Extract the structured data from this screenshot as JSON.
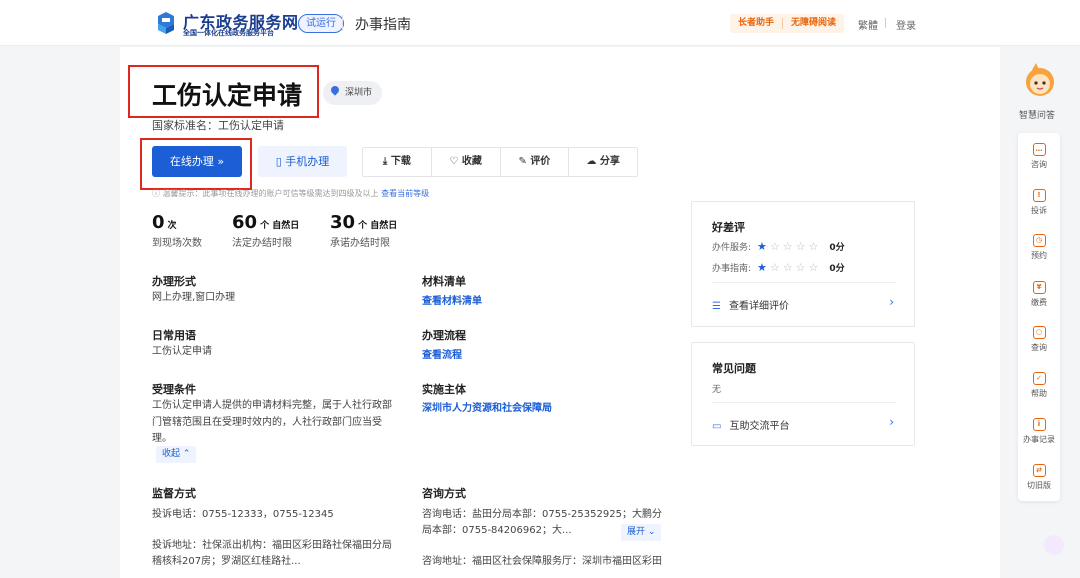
{
  "header": {
    "site_title": "广东政务服务网",
    "site_subtitle": "全国一体化在线政务服务平台",
    "trial_badge": "试运行",
    "section": "办事指南",
    "elder_helper": "长者助手",
    "accessible_reading": "无障碍阅读",
    "traditional": "繁體",
    "login": "登录"
  },
  "service": {
    "title": "工伤认定申请",
    "city": "深圳市",
    "standard_name": "国家标准名：工伤认定申请",
    "online_btn": "在线办理 »",
    "mobile_btn": "手机办理",
    "actions": [
      "下载",
      "收藏",
      "评价",
      "分享"
    ],
    "tip_text": "温馨提示：此事项在线办理的账户可信等级需达到四级及以上",
    "tip_link": "查看当前等级"
  },
  "stats": [
    {
      "num": "0",
      "unit": "次",
      "label": "到现场次数"
    },
    {
      "num": "60",
      "unit": "个 自然日",
      "label": "法定办结时限"
    },
    {
      "num": "30",
      "unit": "个 自然日",
      "label": "承诺办结时限"
    }
  ],
  "details": {
    "form_title": "办理形式",
    "form_value": "网上办理,窗口办理",
    "materials_title": "材料清单",
    "materials_link": "查看材料清单",
    "phrase_title": "日常用语",
    "phrase_value": "工伤认定申请",
    "process_title": "办理流程",
    "process_link": "查看流程",
    "accept_title": "受理条件",
    "accept_line1": "工伤认定申请人提供的申请材料完整，属于人社行政部",
    "accept_line2": "门管辖范围且在受理时效内的，人社行政部门应当受",
    "accept_line3": "理。",
    "collapse": "收起 ⌃",
    "entity_title": "实施主体",
    "entity_link": "深圳市人力资源和社会保障局",
    "supervise_title": "监督方式",
    "supervise_phone": "投诉电话：0755-12333，0755-12345",
    "supervise_addr1": "投诉地址：社保派出机构：福田区彩田路社保福田分局",
    "supervise_addr2": "稽核科207房；罗湖区红桂路社...",
    "consult_title": "咨询方式",
    "consult_phone1": "咨询电话：盐田分局本部：0755-25352925；大鹏分",
    "consult_phone2": "局本部：0755-84206962；大...",
    "expand": "展开 ⌄",
    "consult_addr1": "咨询地址：福田区社会保障服务厅：深圳市福田区彩田"
  },
  "rating": {
    "title": "好差评",
    "rows": [
      {
        "label": "办件服务:",
        "score": "0分"
      },
      {
        "label": "办事指南:",
        "score": "0分"
      }
    ],
    "detail_link": "查看详细评价"
  },
  "faq": {
    "title": "常见问题",
    "value": "无",
    "link": "互助交流平台"
  },
  "side": {
    "assistant": "智慧问答",
    "items": [
      "咨询",
      "投诉",
      "预约",
      "缴费",
      "查询",
      "帮助",
      "办事记录",
      "切旧版"
    ]
  }
}
